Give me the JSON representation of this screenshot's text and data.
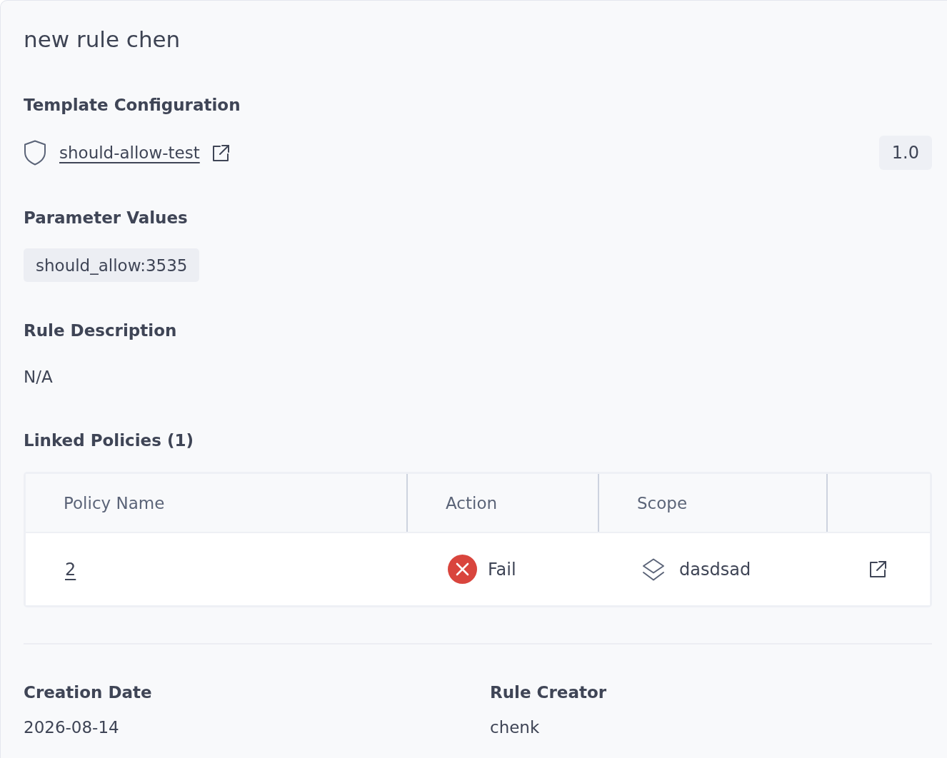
{
  "panel": {
    "title": "new rule chen"
  },
  "template_configuration": {
    "heading": "Template Configuration",
    "template_name": "should-allow-test",
    "version": "1.0"
  },
  "parameter_values": {
    "heading": "Parameter Values",
    "chips": [
      "should_allow:3535"
    ]
  },
  "rule_description": {
    "heading": "Rule Description",
    "text": "N/A"
  },
  "linked_policies": {
    "heading": "Linked Policies (1)",
    "columns": [
      "Policy Name",
      "Action",
      "Scope"
    ],
    "rows": [
      {
        "policy_name": "2",
        "action": {
          "kind": "fail",
          "label": "Fail"
        },
        "scope": "dasdsad"
      }
    ]
  },
  "details": [
    {
      "label": "Creation Date",
      "value": "2026-08-14"
    },
    {
      "label": "Rule Creator",
      "value": "chenk"
    }
  ]
}
